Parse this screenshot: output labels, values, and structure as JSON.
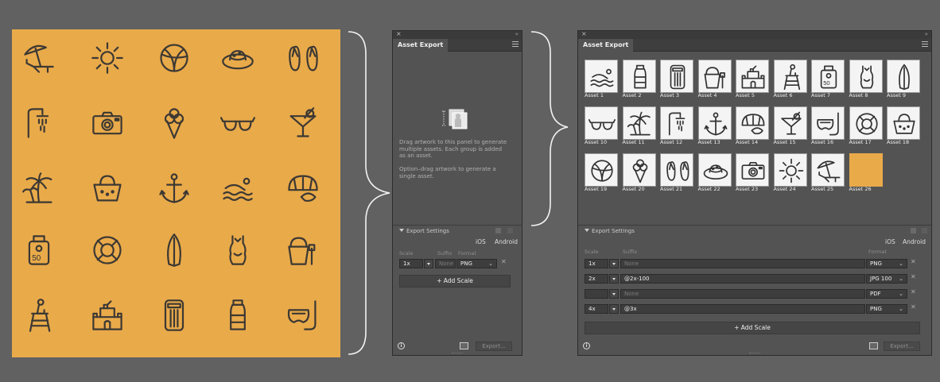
{
  "artboard": {
    "background": "#e9aa4a",
    "icons": [
      [
        "beach-chair-umbrella-icon",
        "sun-icon",
        "beach-ball-icon",
        "sun-hat-icon",
        "flip-flops-icon"
      ],
      [
        "outdoor-shower-icon",
        "camera-icon",
        "ice-cream-icon",
        "sunglasses-icon",
        "cocktail-icon"
      ],
      [
        "palm-trees-icon",
        "beach-bag-icon",
        "anchor-icon",
        "swimmer-icon",
        "seashells-icon"
      ],
      [
        "sunscreen-icon",
        "life-ring-icon",
        "surfboard-icon",
        "swimsuit-icon",
        "sand-bucket-icon"
      ],
      [
        "lifeguard-chair-icon",
        "sandcastle-icon",
        "air-mattress-icon",
        "water-bottle-icon",
        "snorkel-mask-icon"
      ]
    ]
  },
  "panel_empty": {
    "title": "Asset Export",
    "empty_message": [
      "Drag artwork to this panel to generate",
      "multiple assets. Each group is added",
      "as an asset."
    ],
    "option_message": [
      "Option–drag artwork to generate a",
      "single asset."
    ],
    "export_settings_label": "Export Settings",
    "ios_label": "iOS",
    "android_label": "Android",
    "columns": {
      "scale": "Scale",
      "suffix": "Suffix",
      "format": "Format"
    },
    "rows": [
      {
        "scale": "1x",
        "suffix": "None",
        "format": "PNG"
      }
    ],
    "add_scale_label": "+ Add Scale",
    "export_label": "Export..."
  },
  "panel_full": {
    "title": "Asset Export",
    "assets": [
      {
        "label": "Asset 1",
        "icon": "swimmer-icon"
      },
      {
        "label": "Asset 2",
        "icon": "water-bottle-icon"
      },
      {
        "label": "Asset 3",
        "icon": "air-mattress-icon"
      },
      {
        "label": "Asset 4",
        "icon": "sand-bucket-icon"
      },
      {
        "label": "Asset 5",
        "icon": "sandcastle-icon"
      },
      {
        "label": "Asset 6",
        "icon": "lifeguard-chair-icon"
      },
      {
        "label": "Asset 7",
        "icon": "sunscreen-icon"
      },
      {
        "label": "Asset 8",
        "icon": "swimsuit-icon"
      },
      {
        "label": "Asset 9",
        "icon": "surfboard-icon"
      },
      {
        "label": "Asset 10",
        "icon": "sunglasses-icon"
      },
      {
        "label": "Asset 11",
        "icon": "palm-trees-icon"
      },
      {
        "label": "Asset 12",
        "icon": "outdoor-shower-icon"
      },
      {
        "label": "Asset 13",
        "icon": "anchor-icon"
      },
      {
        "label": "Asset 14",
        "icon": "seashells-icon"
      },
      {
        "label": "Asset 15",
        "icon": "cocktail-icon"
      },
      {
        "label": "Asset 16",
        "icon": "snorkel-mask-icon"
      },
      {
        "label": "Asset 17",
        "icon": "life-ring-icon"
      },
      {
        "label": "Asset 18",
        "icon": "beach-bag-icon"
      },
      {
        "label": "Asset 19",
        "icon": "beach-ball-icon"
      },
      {
        "label": "Asset 20",
        "icon": "ice-cream-icon"
      },
      {
        "label": "Asset 21",
        "icon": "flip-flops-icon"
      },
      {
        "label": "Asset 22",
        "icon": "sun-hat-icon"
      },
      {
        "label": "Asset 23",
        "icon": "camera-icon"
      },
      {
        "label": "Asset 24",
        "icon": "sun-icon"
      },
      {
        "label": "Asset 25",
        "icon": "beach-chair-umbrella-icon"
      },
      {
        "label": "Asset 26",
        "icon": "orange-swatch"
      }
    ],
    "export_settings_label": "Export Settings",
    "ios_label": "iOS",
    "android_label": "Android",
    "columns": {
      "scale": "Scale",
      "suffix": "Suffix",
      "format": "Format"
    },
    "rows": [
      {
        "scale": "1x",
        "suffix": "None",
        "format": "PNG"
      },
      {
        "scale": "2x",
        "suffix": "@2x-100",
        "format": "JPG 100"
      },
      {
        "scale": "",
        "suffix": "None",
        "format": "PDF"
      },
      {
        "scale": "4x",
        "suffix": "@3x",
        "format": "PNG"
      }
    ],
    "add_scale_label": "+ Add Scale",
    "export_label": "Export..."
  }
}
